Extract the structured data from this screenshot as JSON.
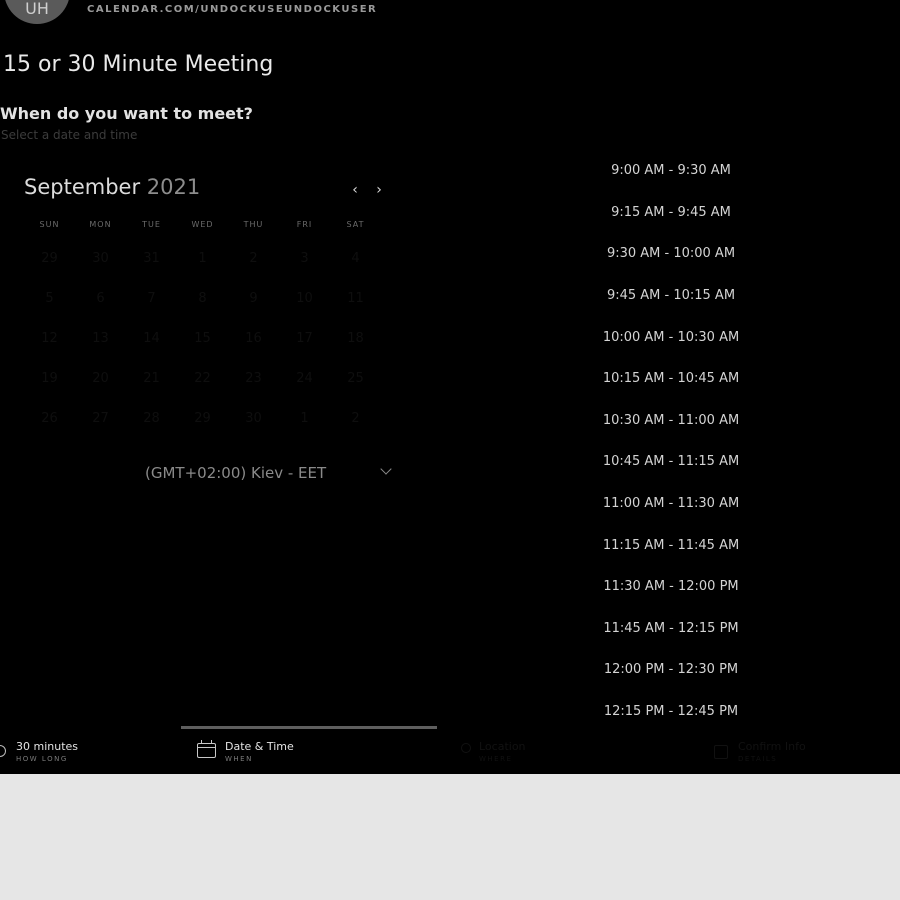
{
  "host": {
    "avatar_initials": "UH",
    "url": "CALENDAR.COM/UNDOCKUSEUNDOCKUSER"
  },
  "event": {
    "title": "15 or 30 Minute Meeting",
    "question": "When do you want to meet?",
    "subtitle": "Select a date and time"
  },
  "calendar": {
    "month": "September",
    "year": "2021",
    "prev_icon": "chevron-left-icon",
    "next_icon": "chevron-right-icon",
    "weekdays": [
      "SUN",
      "MON",
      "TUE",
      "WED",
      "THU",
      "FRI",
      "SAT"
    ],
    "days": [
      "29",
      "30",
      "31",
      "1",
      "2",
      "3",
      "4",
      "5",
      "6",
      "7",
      "8",
      "9",
      "10",
      "11",
      "12",
      "13",
      "14",
      "15",
      "16",
      "17",
      "18",
      "19",
      "20",
      "21",
      "22",
      "23",
      "24",
      "25",
      "26",
      "27",
      "28",
      "29",
      "30",
      "1",
      "2"
    ]
  },
  "timezone": {
    "label": "(GMT+02:00) Kiev - EET",
    "icon": "chevron-down-icon"
  },
  "time_slots": [
    "9:00 AM - 9:30 AM",
    "9:15 AM - 9:45 AM",
    "9:30 AM - 10:00 AM",
    "9:45 AM - 10:15 AM",
    "10:00 AM - 10:30 AM",
    "10:15 AM - 10:45 AM",
    "10:30 AM - 11:00 AM",
    "10:45 AM - 11:15 AM",
    "11:00 AM - 11:30 AM",
    "11:15 AM - 11:45 AM",
    "11:30 AM - 12:00 PM",
    "11:45 AM - 12:15 PM",
    "12:00 PM - 12:30 PM",
    "12:15 PM - 12:45 PM"
  ],
  "steps": {
    "duration": {
      "label": "30 minutes",
      "sub": "HOW LONG",
      "icon": "clock-icon"
    },
    "date_time": {
      "label": "Date & Time",
      "sub": "WHEN",
      "icon": "calendar-icon"
    },
    "location": {
      "label": "Location",
      "sub": "WHERE",
      "icon": "location-pin-icon"
    },
    "confirm": {
      "label": "Confirm Info",
      "sub": "DETAILS",
      "icon": "checkbox-icon"
    }
  },
  "colors": {
    "panel_background": "#000000",
    "page_background": "#e6e6e6",
    "slot_text": "#d4d4d4",
    "active_step_bar": "#5e5e5e"
  }
}
